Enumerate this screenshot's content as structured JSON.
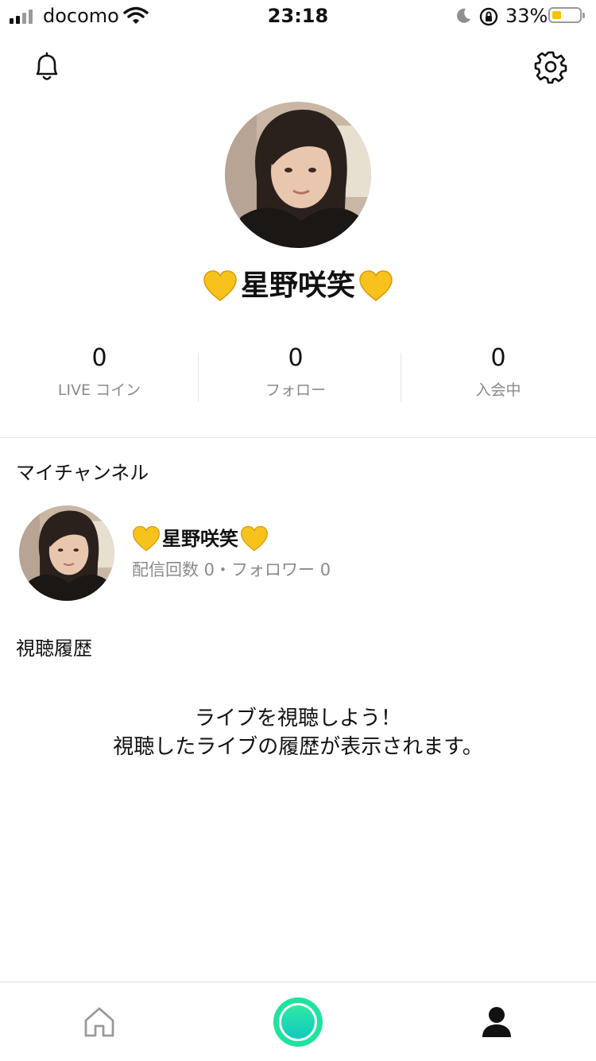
{
  "status_bar": {
    "carrier": "docomo",
    "time": "23:18",
    "battery_percent": "33%",
    "icons": [
      "signal-icon",
      "wifi-icon",
      "moon-icon",
      "rotation-lock-icon",
      "battery-icon"
    ],
    "battery_level": 0.33,
    "battery_color": "#f5c400"
  },
  "header": {
    "left_icon": "bell-icon",
    "right_icon": "gear-icon"
  },
  "profile": {
    "name": "星野咲笑",
    "heart_color": "#f7c21c"
  },
  "stats": [
    {
      "value": "0",
      "label": "LIVE コイン"
    },
    {
      "value": "0",
      "label": "フォロー"
    },
    {
      "value": "0",
      "label": "入会中"
    }
  ],
  "my_channel": {
    "title": "マイチャンネル",
    "name": "星野咲笑",
    "stats_text": "配信回数 0・フォロワー 0"
  },
  "history": {
    "title": "視聴履歴",
    "empty_line1": "ライブを視聴しよう！",
    "empty_line2": "視聴したライブの履歴が表示されます。"
  },
  "tab_bar": {
    "tabs": [
      "home-icon",
      "live-icon",
      "profile-icon"
    ],
    "active_tab": "profile-icon",
    "accent_color": "#1ee39e"
  }
}
